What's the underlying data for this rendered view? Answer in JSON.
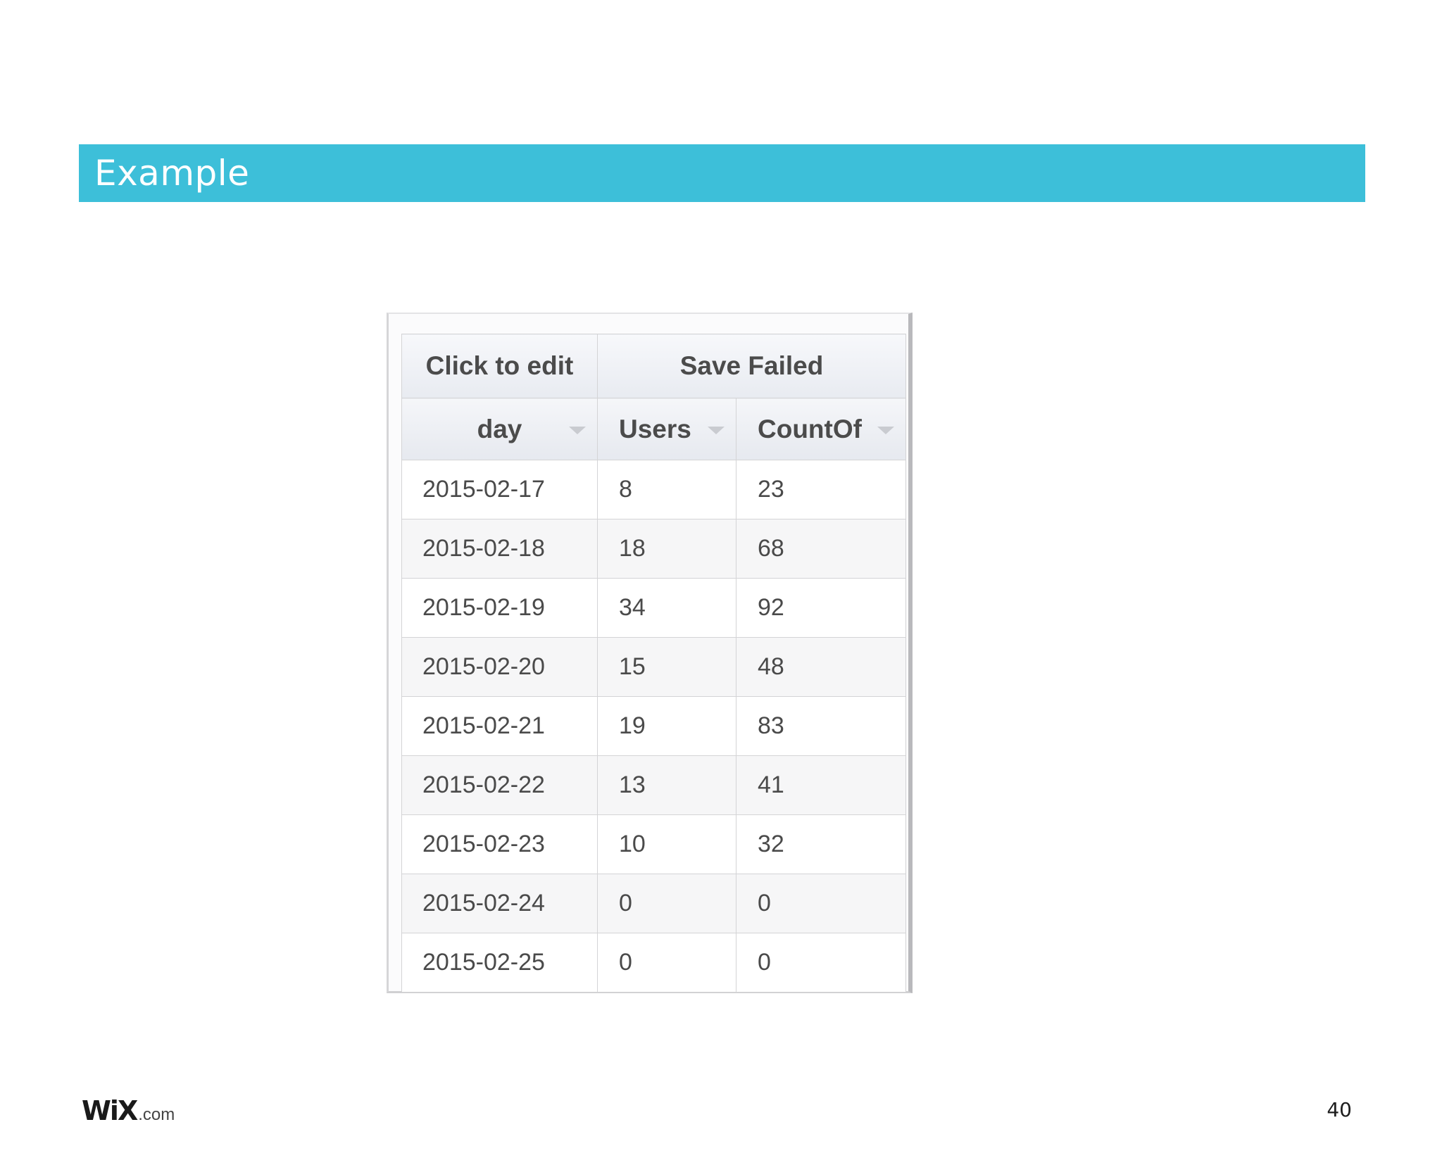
{
  "slide": {
    "title": "Example",
    "page_number": "40",
    "colors": {
      "title_bar": "#3dbfd9",
      "title_text": "#ffffff"
    }
  },
  "grid": {
    "group_headers": [
      "Click to edit",
      "Save Failed"
    ],
    "columns": [
      "day",
      "Users",
      "CountOf"
    ],
    "rows": [
      [
        "2015-02-17",
        "8",
        "23"
      ],
      [
        "2015-02-18",
        "18",
        "68"
      ],
      [
        "2015-02-19",
        "34",
        "92"
      ],
      [
        "2015-02-20",
        "15",
        "48"
      ],
      [
        "2015-02-21",
        "19",
        "83"
      ],
      [
        "2015-02-22",
        "13",
        "41"
      ],
      [
        "2015-02-23",
        "10",
        "32"
      ],
      [
        "2015-02-24",
        "0",
        "0"
      ],
      [
        "2015-02-25",
        "0",
        "0"
      ]
    ]
  },
  "footer": {
    "logo_main": "WiX",
    "logo_suffix": ".com"
  },
  "icons": {
    "sort": "chevron-down-icon"
  }
}
